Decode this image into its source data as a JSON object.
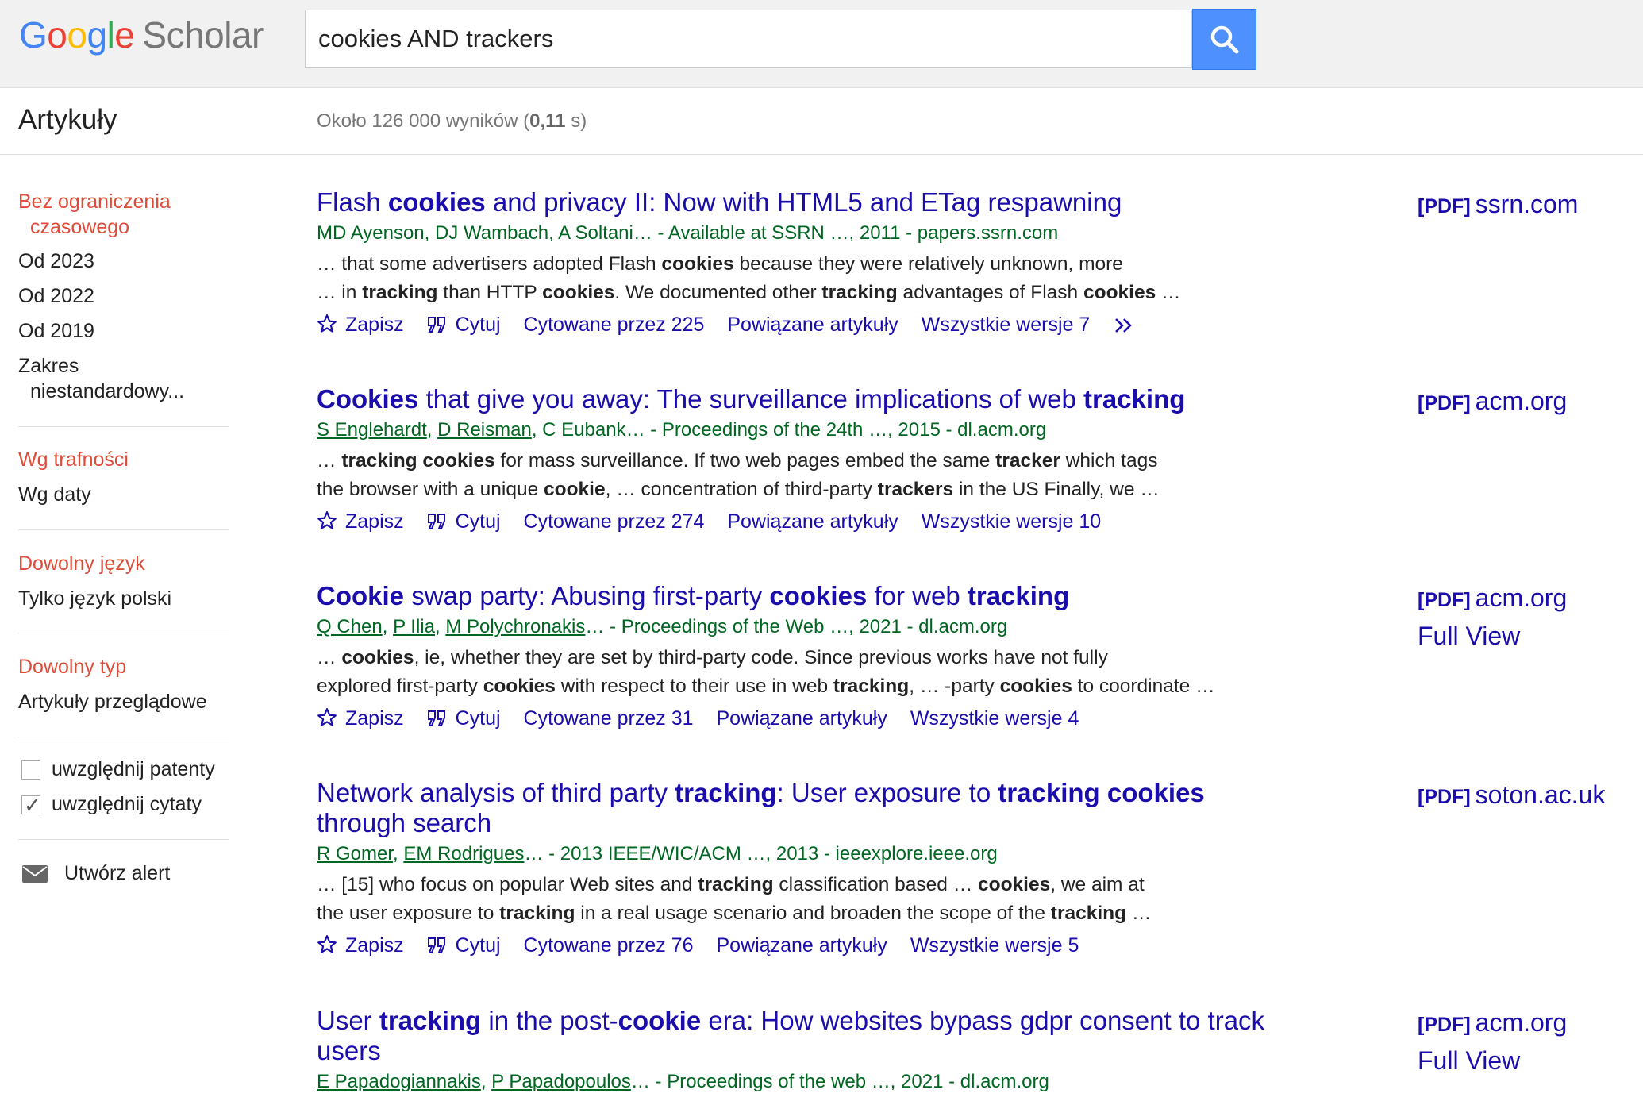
{
  "header": {
    "logo": {
      "google": [
        "G",
        "o",
        "o",
        "g",
        "l",
        "e"
      ],
      "scholar": "Scholar"
    },
    "search_value": "cookies AND trackers"
  },
  "subbar": {
    "title": "Artykuły",
    "results_prefix": "Około 126 000 wyników (",
    "results_time": "0,11",
    "results_suffix": " s)"
  },
  "sidebar": {
    "time_active_line1": "Bez ograniczenia",
    "time_active_line2": "czasowego",
    "time_options": [
      "Od 2023",
      "Od 2022",
      "Od 2019"
    ],
    "custom_range_line1": "Zakres",
    "custom_range_line2": "niestandardowy...",
    "sort_active": "Wg trafności",
    "sort_other": "Wg daty",
    "lang_active": "Dowolny język",
    "lang_other": "Tylko język polski",
    "type_active": "Dowolny typ",
    "type_other": "Artykuły przeglądowe",
    "include_patents": "uwzględnij patenty",
    "include_citations": "uwzględnij cytaty",
    "create_alert": "Utwórz alert"
  },
  "actions": {
    "save": "Zapisz",
    "cite": "Cytuj",
    "related": "Powiązane artykuły"
  },
  "results": [
    {
      "title_parts": [
        [
          "Flash ",
          0
        ],
        [
          "cookies",
          1
        ],
        [
          " and privacy II: Now with HTML5 and ETag respawning",
          0
        ]
      ],
      "authors_plain": "MD Ayenson, DJ Wambach, A Soltani",
      "authors_suffix": "… - Available at SSRN …, 2011 - papers.ssrn.com",
      "snippet1": [
        [
          "… that some advertisers adopted Flash ",
          0
        ],
        [
          "cookies",
          1
        ],
        [
          " because they were relatively unknown, more",
          0
        ]
      ],
      "snippet2": [
        [
          "… in ",
          0
        ],
        [
          "tracking",
          1
        ],
        [
          " than HTTP ",
          0
        ],
        [
          "cookies",
          1
        ],
        [
          ". We documented other ",
          0
        ],
        [
          "tracking",
          1
        ],
        [
          " advantages of Flash ",
          0
        ],
        [
          "cookies",
          1
        ],
        [
          " …",
          0
        ]
      ],
      "cited": "Cytowane przez 225",
      "versions": "Wszystkie wersje 7",
      "pdf": "[PDF]",
      "source": "ssrn.com"
    },
    {
      "title_parts": [
        [
          "Cookies",
          1
        ],
        [
          " that give you away: The surveillance implications of web ",
          0
        ],
        [
          "tracking",
          1
        ]
      ],
      "authors_links": [
        "S Englehardt",
        "D Reisman"
      ],
      "authors_plain": "C Eubank",
      "authors_suffix": "… - Proceedings of the 24th …, 2015 - dl.acm.org",
      "snippet1": [
        [
          "… ",
          0
        ],
        [
          "tracking cookies",
          1
        ],
        [
          " for mass surveillance. If two web pages embed the same ",
          0
        ],
        [
          "tracker",
          1
        ],
        [
          " which tags",
          0
        ]
      ],
      "snippet2": [
        [
          "the browser with a unique ",
          0
        ],
        [
          "cookie",
          1
        ],
        [
          ", … concentration of third-party ",
          0
        ],
        [
          "trackers",
          1
        ],
        [
          " in the US Finally, we …",
          0
        ]
      ],
      "cited": "Cytowane przez 274",
      "versions": "Wszystkie wersje 10",
      "pdf": "[PDF]",
      "source": "acm.org"
    },
    {
      "title_parts": [
        [
          "Cookie",
          1
        ],
        [
          " swap party: Abusing first-party ",
          0
        ],
        [
          "cookies",
          1
        ],
        [
          " for web ",
          0
        ],
        [
          "tracking",
          1
        ]
      ],
      "authors_links": [
        "Q Chen",
        "P Ilia",
        "M Polychronakis"
      ],
      "authors_suffix": "… - Proceedings of the Web …, 2021 - dl.acm.org",
      "snippet1": [
        [
          "… ",
          0
        ],
        [
          "cookies",
          1
        ],
        [
          ", ie, whether they are set by third-party code. Since previous works have not fully",
          0
        ]
      ],
      "snippet2": [
        [
          "explored first-party ",
          0
        ],
        [
          "cookies",
          1
        ],
        [
          " with respect to their use in web ",
          0
        ],
        [
          "tracking",
          1
        ],
        [
          ", … -party ",
          0
        ],
        [
          "cookies",
          1
        ],
        [
          " to coordinate …",
          0
        ]
      ],
      "cited": "Cytowane przez 31",
      "versions": "Wszystkie wersje 4",
      "pdf": "[PDF]",
      "source": "acm.org",
      "full_view": "Full View"
    },
    {
      "title_parts": [
        [
          "Network analysis of third party ",
          0
        ],
        [
          "tracking",
          1
        ],
        [
          ": User exposure to ",
          0
        ],
        [
          "tracking cookies",
          1
        ],
        [
          " through search",
          0
        ]
      ],
      "authors_links": [
        "R Gomer",
        "EM Rodrigues"
      ],
      "authors_suffix": "… - 2013 IEEE/WIC/ACM …, 2013 - ieeexplore.ieee.org",
      "snippet1": [
        [
          "… [15] who focus on popular Web sites and ",
          0
        ],
        [
          "tracking",
          1
        ],
        [
          " classification based … ",
          0
        ],
        [
          "cookies",
          1
        ],
        [
          ", we aim at",
          0
        ]
      ],
      "snippet2": [
        [
          "the user exposure to ",
          0
        ],
        [
          "tracking",
          1
        ],
        [
          " in a real usage scenario and broaden the scope of the ",
          0
        ],
        [
          "tracking",
          1
        ],
        [
          " …",
          0
        ]
      ],
      "cited": "Cytowane przez 76",
      "versions": "Wszystkie wersje 5",
      "pdf": "[PDF]",
      "source": "soton.ac.uk"
    },
    {
      "title_parts": [
        [
          "User ",
          0
        ],
        [
          "tracking",
          1
        ],
        [
          " in the post-",
          0
        ],
        [
          "cookie",
          1
        ],
        [
          " era: How websites bypass gdpr consent to track users",
          0
        ]
      ],
      "authors_links": [
        "E Papadogiannakis",
        "P Papadopoulos"
      ],
      "authors_suffix": "… - Proceedings of the web …, 2021 - dl.acm.org",
      "pdf": "[PDF]",
      "source": "acm.org",
      "full_view": "Full View"
    }
  ]
}
